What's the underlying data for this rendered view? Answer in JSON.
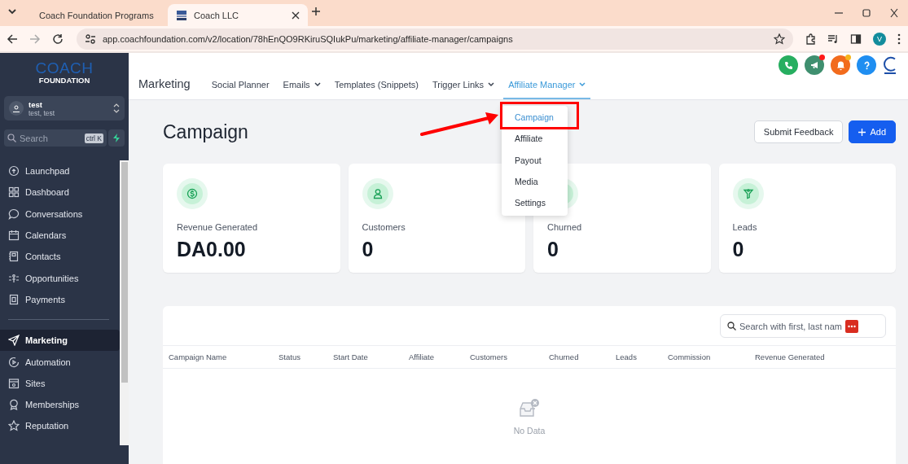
{
  "browser": {
    "tabs": [
      {
        "title": "Coach Foundation Programs",
        "selected": false
      },
      {
        "title": "Coach LLC",
        "selected": true
      }
    ],
    "url": "app.coachfoundation.com/v2/location/78hEnQO9RKiruSQIukPu/marketing/affiliate-manager/campaigns",
    "profile_initial": "V"
  },
  "sidebar": {
    "logo_top": "COACH",
    "logo_bottom": "FOUNDATION",
    "account": {
      "name": "test",
      "subtitle": "test, test"
    },
    "search": {
      "placeholder": "Search",
      "shortcut": "ctrl K"
    },
    "sections": [
      [
        {
          "label": "Launchpad",
          "selected": false
        },
        {
          "label": "Dashboard",
          "selected": false
        },
        {
          "label": "Conversations",
          "selected": false
        },
        {
          "label": "Calendars",
          "selected": false
        },
        {
          "label": "Contacts",
          "selected": false
        },
        {
          "label": "Opportunities",
          "selected": false
        },
        {
          "label": "Payments",
          "selected": false
        }
      ],
      [
        {
          "label": "Marketing",
          "selected": true
        },
        {
          "label": "Automation",
          "selected": false
        },
        {
          "label": "Sites",
          "selected": false
        },
        {
          "label": "Memberships",
          "selected": false
        },
        {
          "label": "Reputation",
          "selected": false
        }
      ]
    ]
  },
  "header": {
    "actions": [
      {
        "kind": "phone",
        "alert": false
      },
      {
        "kind": "megaphone",
        "alert": true
      },
      {
        "kind": "bell",
        "alert": true
      },
      {
        "kind": "help",
        "alert": false
      }
    ],
    "nav_title": "Marketing",
    "nav": [
      {
        "label": "Social Planner",
        "dropdown": false,
        "selected": false
      },
      {
        "label": "Emails",
        "dropdown": true,
        "selected": false
      },
      {
        "label": "Templates (Snippets)",
        "dropdown": false,
        "selected": false
      },
      {
        "label": "Trigger Links",
        "dropdown": true,
        "selected": false
      },
      {
        "label": "Affiliate Manager",
        "dropdown": true,
        "selected": true
      }
    ]
  },
  "menu": {
    "items": [
      {
        "label": "Campaign",
        "selected": true
      },
      {
        "label": "Affiliate",
        "selected": false
      },
      {
        "label": "Payout",
        "selected": false
      },
      {
        "label": "Media",
        "selected": false
      },
      {
        "label": "Settings",
        "selected": false
      }
    ]
  },
  "page": {
    "title": "Campaign",
    "buttons": [
      {
        "label": "Submit Feedback",
        "kind": "secondary"
      },
      {
        "label": "Add",
        "kind": "primary"
      }
    ]
  },
  "stats": [
    {
      "label": "Revenue Generated",
      "value": "DA0.00"
    },
    {
      "label": "Customers",
      "value": "0"
    },
    {
      "label": "Churned",
      "value": "0"
    },
    {
      "label": "Leads",
      "value": "0"
    }
  ],
  "table": {
    "search": {
      "placeholder": "Search with first, last nam"
    },
    "columns": [
      "Campaign Name",
      "Status",
      "Start Date",
      "Affiliate",
      "Customers",
      "Churned",
      "Leads",
      "Commission",
      "Revenue Generated"
    ],
    "empty_text": "No Data"
  }
}
